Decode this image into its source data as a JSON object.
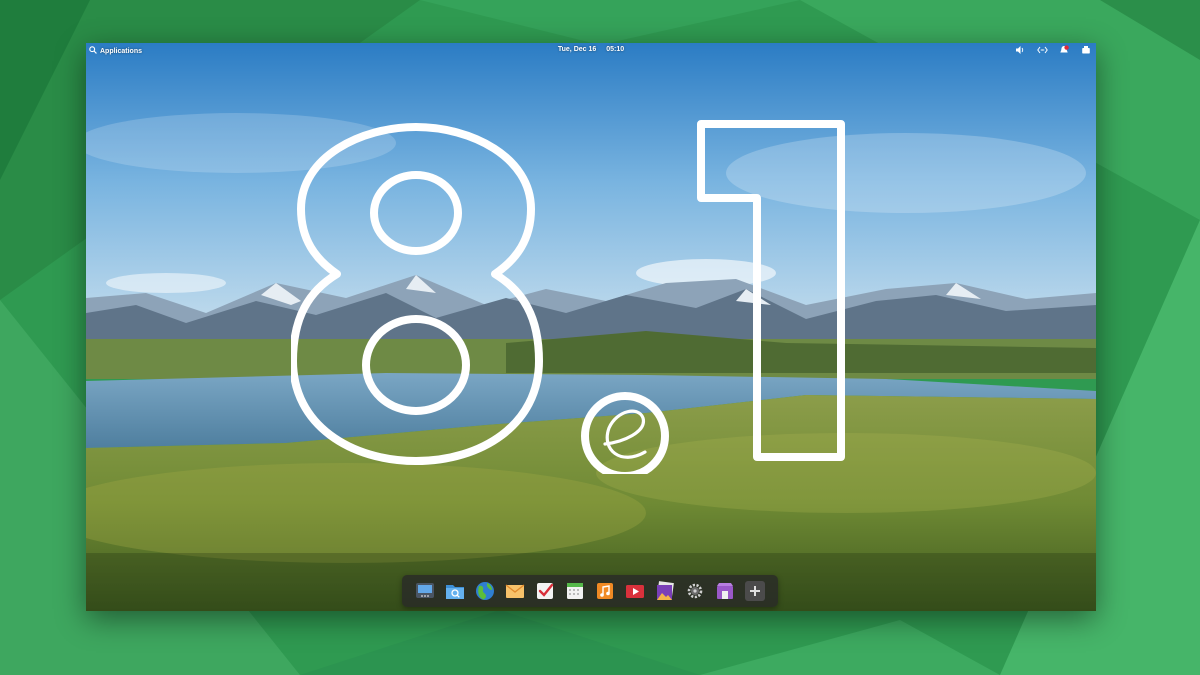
{
  "panel": {
    "applications_label": "Applications",
    "date": "Tue, Dec 16",
    "time": "05:10",
    "indicators": [
      "volume-icon",
      "network-icon",
      "notifications-icon",
      "power-icon"
    ]
  },
  "hero": {
    "version_text": "8.1",
    "logo": "elementary-logo"
  },
  "dock": {
    "apps": [
      "multitasking-view-icon",
      "files-icon",
      "web-browser-icon",
      "mail-icon",
      "tasks-icon",
      "calendar-icon",
      "music-icon",
      "videos-icon",
      "photos-icon",
      "system-settings-icon",
      "appcenter-icon",
      "add-icon"
    ]
  },
  "colors": {
    "background": "#2e9b53",
    "dock": "#2a2a2a",
    "panel_text": "#ffffff"
  }
}
